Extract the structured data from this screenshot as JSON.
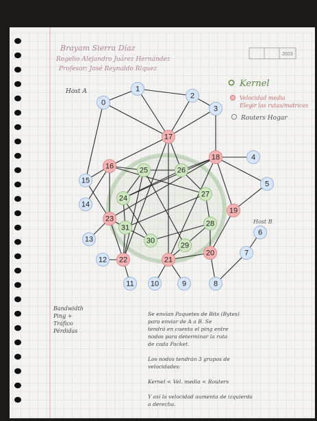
{
  "header": {
    "line1": "Brayam Sierra Díaz",
    "line2": "Rogelio Alejandro Juárez Hernández",
    "line3": "Profesor: José Reynaldo Riquez",
    "date": [
      "",
      "",
      "2023"
    ]
  },
  "left_note": {
    "label": "Host A"
  },
  "legend": {
    "kernel": "Kernel",
    "velocidad": "Velocidad media",
    "velocidad2": "Elegir las rutas/matrices",
    "routers": "Routers Hogar"
  },
  "side_note": "Host B",
  "bottom_left_note": [
    "Bandwidth",
    "Ping +",
    "Tráfico",
    "Pérdidas"
  ],
  "bottom_right_note": [
    "Se envían Paquetes de Bits (Bytes)",
    "para enviar de A a B. Se",
    "tendrá en cuenta el ping entre",
    "nodos para determinar la ruta",
    "de cada Packet.",
    "",
    "Los nodos tendrán 3 grupos de",
    "velocidades:",
    "",
    "Kernel < Vel. media < Routers",
    "",
    "Y así la velocidad aumenta de izquierda",
    "a derecha."
  ],
  "colors": {
    "red": "#f6b3b3",
    "green": "#cfe8c2",
    "blue": "#d7e6f9",
    "kernel_text": "#5b8c46",
    "title_ink": "#b28292"
  },
  "graph": {
    "nodes": [
      {
        "id": "0",
        "group": "blue"
      },
      {
        "id": "1",
        "group": "blue"
      },
      {
        "id": "2",
        "group": "blue"
      },
      {
        "id": "3",
        "group": "blue"
      },
      {
        "id": "4",
        "group": "blue"
      },
      {
        "id": "5",
        "group": "blue"
      },
      {
        "id": "6",
        "group": "blue"
      },
      {
        "id": "7",
        "group": "blue"
      },
      {
        "id": "8",
        "group": "blue"
      },
      {
        "id": "9",
        "group": "blue"
      },
      {
        "id": "10",
        "group": "blue"
      },
      {
        "id": "11",
        "group": "blue"
      },
      {
        "id": "12",
        "group": "blue"
      },
      {
        "id": "13",
        "group": "blue"
      },
      {
        "id": "14",
        "group": "blue"
      },
      {
        "id": "15",
        "group": "blue"
      },
      {
        "id": "16",
        "group": "red"
      },
      {
        "id": "17",
        "group": "red"
      },
      {
        "id": "18",
        "group": "red"
      },
      {
        "id": "19",
        "group": "red"
      },
      {
        "id": "20",
        "group": "red"
      },
      {
        "id": "21",
        "group": "red"
      },
      {
        "id": "22",
        "group": "red"
      },
      {
        "id": "23",
        "group": "red"
      },
      {
        "id": "24",
        "group": "green"
      },
      {
        "id": "25",
        "group": "green"
      },
      {
        "id": "26",
        "group": "green"
      },
      {
        "id": "27",
        "group": "green"
      },
      {
        "id": "28",
        "group": "green"
      },
      {
        "id": "29",
        "group": "green"
      },
      {
        "id": "30",
        "group": "green"
      },
      {
        "id": "31",
        "group": "green"
      }
    ],
    "edges": [
      [
        "0",
        "1"
      ],
      [
        "1",
        "2"
      ],
      [
        "2",
        "3"
      ],
      [
        "0",
        "17"
      ],
      [
        "1",
        "17"
      ],
      [
        "2",
        "17"
      ],
      [
        "3",
        "17"
      ],
      [
        "0",
        "15"
      ],
      [
        "3",
        "18"
      ],
      [
        "18",
        "4"
      ],
      [
        "18",
        "5"
      ],
      [
        "17",
        "16"
      ],
      [
        "17",
        "26"
      ],
      [
        "17",
        "22"
      ],
      [
        "17",
        "21"
      ],
      [
        "16",
        "15"
      ],
      [
        "16",
        "14"
      ],
      [
        "16",
        "23"
      ],
      [
        "16",
        "25"
      ],
      [
        "15",
        "23"
      ],
      [
        "23",
        "13"
      ],
      [
        "23",
        "22"
      ],
      [
        "23",
        "31"
      ],
      [
        "24",
        "25"
      ],
      [
        "24",
        "31"
      ],
      [
        "24",
        "18"
      ],
      [
        "24",
        "30"
      ],
      [
        "25",
        "26"
      ],
      [
        "25",
        "29"
      ],
      [
        "26",
        "18"
      ],
      [
        "26",
        "27"
      ],
      [
        "26",
        "24"
      ],
      [
        "27",
        "28"
      ],
      [
        "27",
        "31"
      ],
      [
        "28",
        "29"
      ],
      [
        "28",
        "30"
      ],
      [
        "18",
        "19"
      ],
      [
        "19",
        "5"
      ],
      [
        "19",
        "20"
      ],
      [
        "20",
        "21"
      ],
      [
        "20",
        "8"
      ],
      [
        "20",
        "28"
      ],
      [
        "6",
        "7"
      ],
      [
        "7",
        "8"
      ],
      [
        "21",
        "9"
      ],
      [
        "21",
        "10"
      ],
      [
        "21",
        "18"
      ],
      [
        "22",
        "12"
      ],
      [
        "22",
        "11"
      ],
      [
        "22",
        "31"
      ],
      [
        "30",
        "31"
      ],
      [
        "29",
        "21"
      ],
      [
        "25",
        "22"
      ],
      [
        "18",
        "23"
      ],
      [
        "16",
        "27"
      ]
    ]
  }
}
